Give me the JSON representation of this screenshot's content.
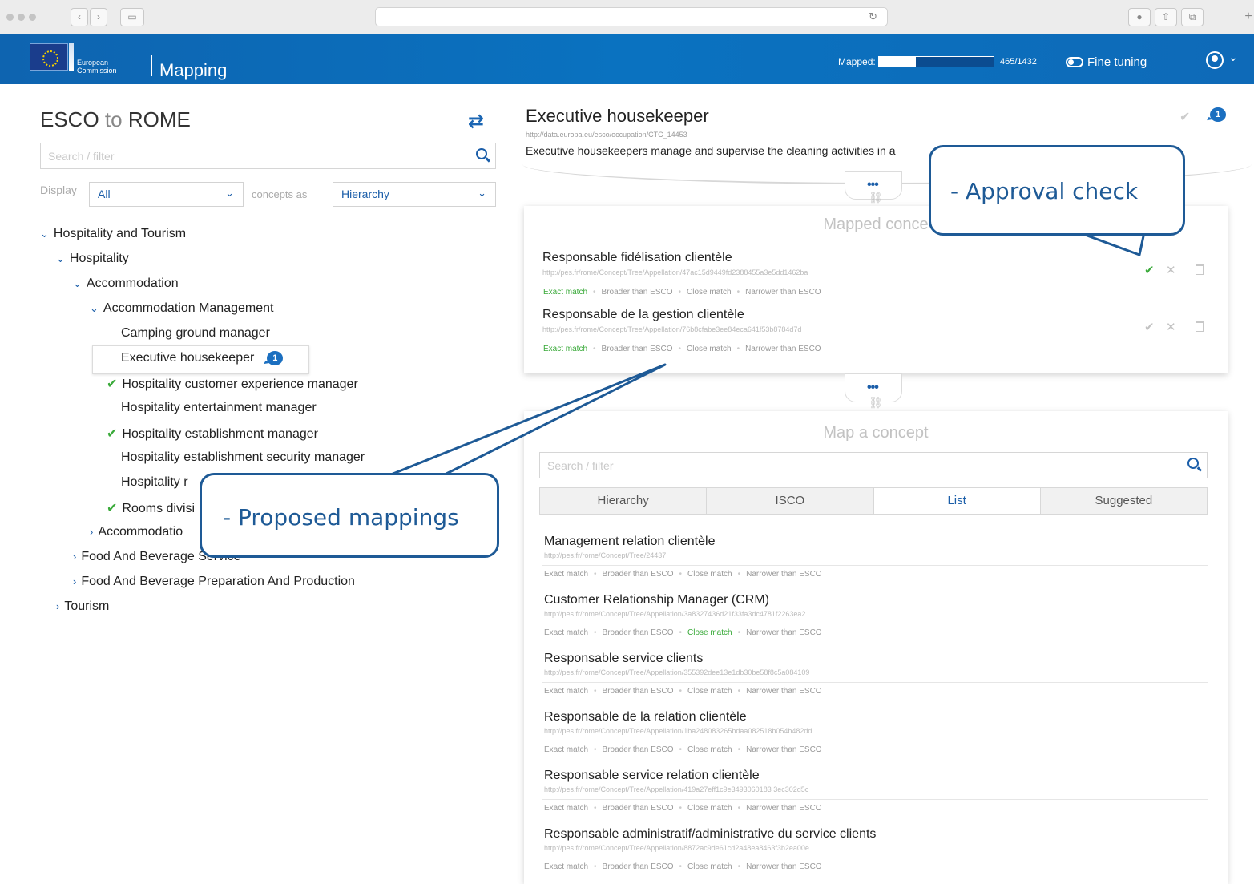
{
  "browser": {
    "back": "‹",
    "forward": "›",
    "reload": "↻"
  },
  "header": {
    "logo_line1": "European",
    "logo_line2": "Commission",
    "app_title": "Mapping",
    "mapped_label": "Mapped:",
    "mapped_fraction": 0.325,
    "mapped_count": "465/1432",
    "fine_tuning": "Fine tuning"
  },
  "left": {
    "title_from": "ESCO",
    "title_to": "to",
    "title_target": "ROME",
    "search_placeholder": "Search / filter",
    "display_label": "Display",
    "display_value": "All",
    "concepts_label": "concepts as",
    "concepts_value": "Hierarchy",
    "tree": [
      {
        "label": "Hospitality and Tourism",
        "caret": "⌄",
        "check": false
      },
      {
        "label": "Hospitality",
        "caret": "⌄",
        "check": false
      },
      {
        "label": "Accommodation",
        "caret": "⌄",
        "check": false
      },
      {
        "label": "Accommodation Management",
        "caret": "⌄",
        "check": false
      },
      {
        "label": "Camping ground manager",
        "caret": "",
        "check": false
      },
      {
        "label": "Executive housekeeper",
        "caret": "",
        "check": false,
        "badge": "1"
      },
      {
        "label": "Hospitality customer experience manager",
        "caret": "",
        "check": true
      },
      {
        "label": "Hospitality entertainment manager",
        "caret": "",
        "check": false
      },
      {
        "label": "Hospitality establishment manager",
        "caret": "",
        "check": true
      },
      {
        "label": "Hospitality establishment security manager",
        "caret": "",
        "check": false
      },
      {
        "label": "Hospitality r",
        "caret": "",
        "check": false
      },
      {
        "label": "Rooms divisi",
        "caret": "",
        "check": true
      },
      {
        "label": "Accommodatio",
        "caret": "›",
        "check": false
      },
      {
        "label": "Food And Beverage Service",
        "caret": "›",
        "check": false
      },
      {
        "label": "Food And Beverage Preparation And Production",
        "caret": "›",
        "check": false
      },
      {
        "label": "Tourism",
        "caret": "›",
        "check": false
      }
    ]
  },
  "concept": {
    "title": "Executive housekeeper",
    "uri": "http://data.europa.eu/esco/occupation/CTC_14453",
    "description": "Executive housekeepers manage and supervise the cleaning activities in a",
    "badge": "1"
  },
  "mapped": {
    "heading": "Mapped conce",
    "rows": [
      {
        "name": "Responsable fidélisation clientèle",
        "uri": "http://pes.fr/rome/Concept/Tree/Appellation/47ac15d9449fd2388455a3e5dd1462ba",
        "approved": true
      },
      {
        "name": "Responsable de la gestion clientèle",
        "uri": "http://pes.fr/rome/Concept/Tree/Appellation/76b8cfabe3ee84eca641f53b8784d7d",
        "approved": false
      }
    ]
  },
  "match_types": [
    "Exact match",
    "Broader than ESCO",
    "Close match",
    "Narrower than ESCO"
  ],
  "map": {
    "heading": "Map a concept",
    "search_placeholder": "Search / filter",
    "tabs": [
      "Hierarchy",
      "ISCO",
      "List",
      "Suggested"
    ],
    "active_tab": "List",
    "items": [
      {
        "name": "Management relation clientèle",
        "uri": "http://pes.fr/rome/Concept/Tree/24437",
        "active_match": ""
      },
      {
        "name": "Customer Relationship Manager (CRM)",
        "uri": "http://pes.fr/rome/Concept/Tree/Appellation/3a8327436d21f33fa3dc4781f2263ea2",
        "active_match": "Close match"
      },
      {
        "name": "Responsable service clients",
        "uri": "http://pes.fr/rome/Concept/Tree/Appellation/355392dee13e1db30be58f8c5a084109",
        "active_match": ""
      },
      {
        "name": "Responsable de la relation clientèle",
        "uri": "http://pes.fr/rome/Concept/Tree/Appellation/1ba248083265bdaa082518b054b482dd",
        "active_match": ""
      },
      {
        "name": "Responsable service relation clientèle",
        "uri": "http://pes.fr/rome/Concept/Tree/Appellation/419a27eff1c9e3493060183 3ec302d5c",
        "active_match": ""
      },
      {
        "name": "Responsable administratif/administrative du service clients",
        "uri": "http://pes.fr/rome/Concept/Tree/Appellation/8872ac9de61cd2a48ea8463f3b2ea00e",
        "active_match": ""
      }
    ]
  },
  "callouts": {
    "approval": "-  Approval check",
    "proposed": "-  Proposed mappings"
  },
  "colors": {
    "brand_blue": "#0a72c0",
    "approve_green": "#3aaa3a",
    "callout_blue": "#1e5a96"
  }
}
